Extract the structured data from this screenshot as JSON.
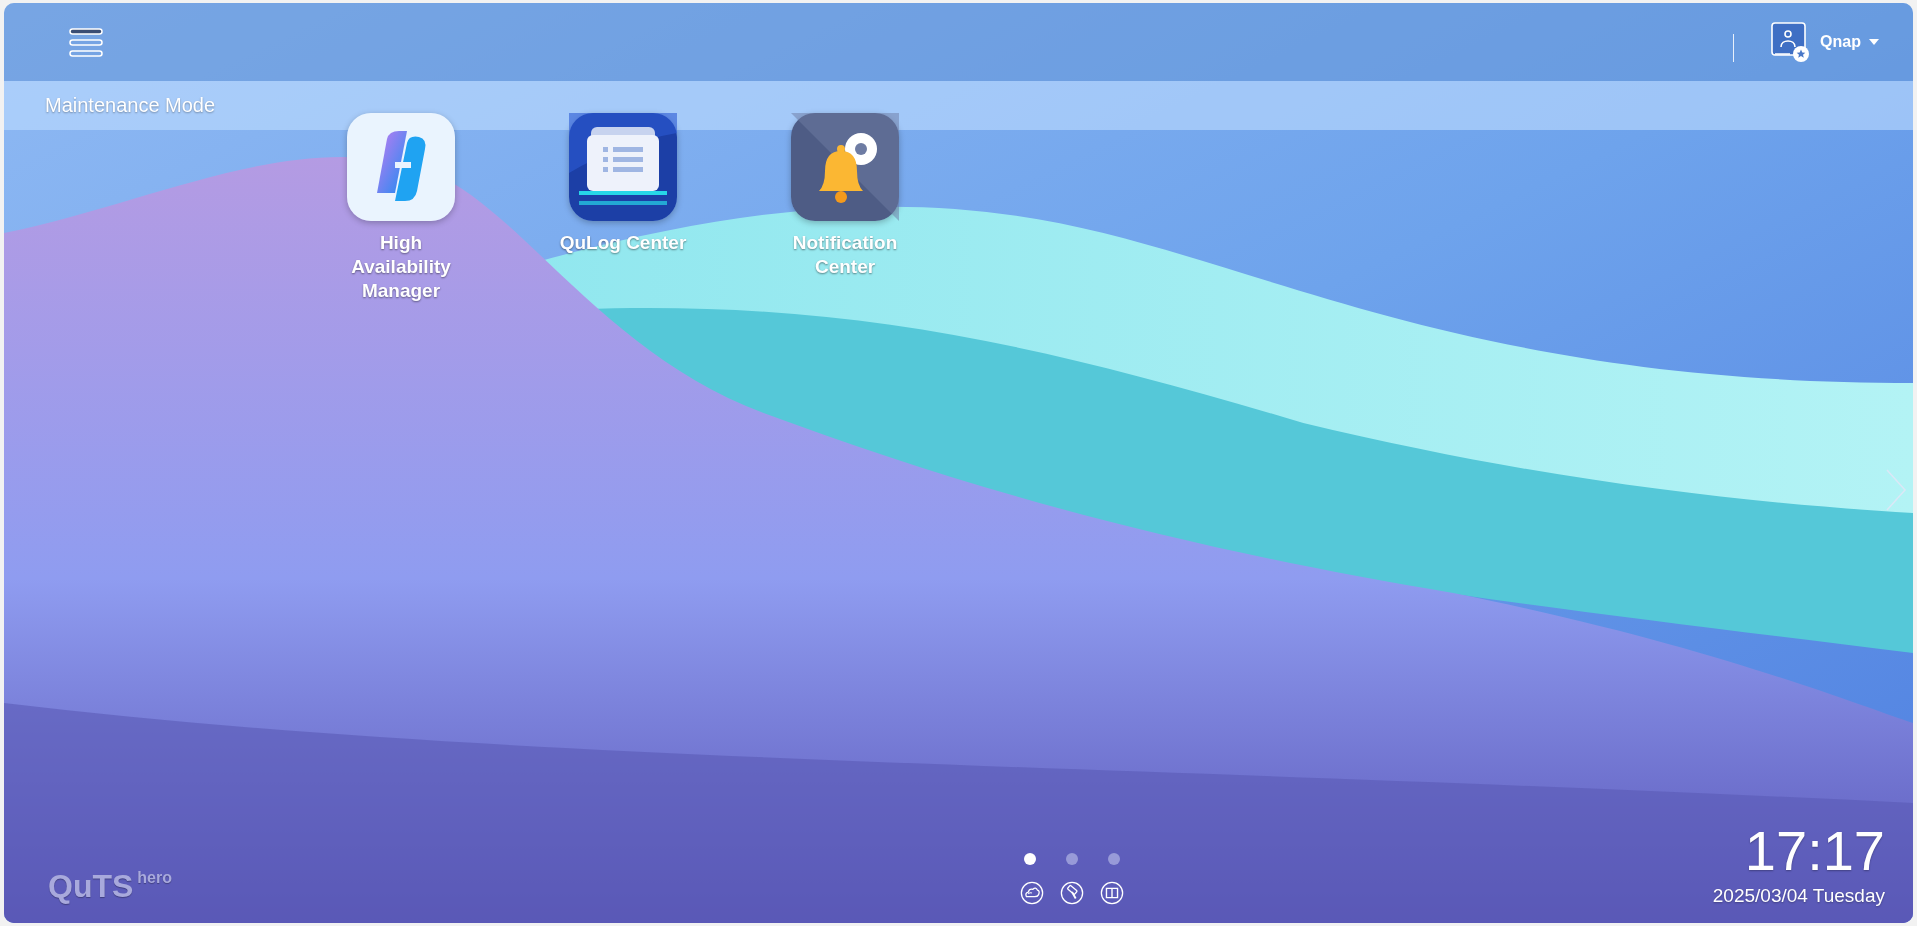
{
  "top_bar": {
    "user_name": "Qnap"
  },
  "mode_banner": "Maintenance Mode",
  "apps": [
    {
      "kind": "ha",
      "label": "High Availability Manager"
    },
    {
      "kind": "qulog",
      "label": "QuLog Center"
    },
    {
      "kind": "notification",
      "label": "Notification Center"
    }
  ],
  "pages": [
    {
      "selected": true
    },
    {
      "selected": false
    },
    {
      "selected": false
    }
  ],
  "quick_links": [
    {
      "kind": "cloud"
    },
    {
      "kind": "tool"
    },
    {
      "kind": "book"
    }
  ],
  "logo": {
    "brand": "QuTS",
    "edition": "hero"
  },
  "clock": {
    "time": "17:17",
    "date": "2025/03/04 Tuesday"
  }
}
